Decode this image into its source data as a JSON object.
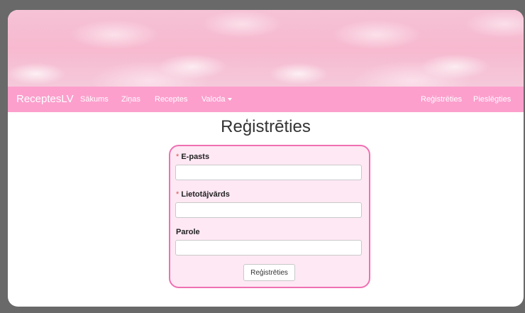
{
  "navbar": {
    "brand": "ReceptesLV",
    "items": [
      {
        "label": "Sākums"
      },
      {
        "label": "Ziņas"
      },
      {
        "label": "Receptes"
      },
      {
        "label": "Valoda"
      }
    ],
    "right_items": [
      {
        "label": "Reģistrēties"
      },
      {
        "label": "Pieslēgties"
      }
    ]
  },
  "page": {
    "title": "Reģistrēties"
  },
  "form": {
    "required_marker": "*",
    "fields": [
      {
        "label": "E-pasts",
        "value": "",
        "required": true
      },
      {
        "label": "Lietotājvārds",
        "value": "",
        "required": true
      },
      {
        "label": "Parole",
        "value": "",
        "required": false
      }
    ],
    "submit_label": "Reģistrēties"
  },
  "colors": {
    "navbar": "#fc9fcd",
    "form_border": "#ef70b2",
    "form_background": "#fee8f4",
    "outer_background": "#696969"
  }
}
